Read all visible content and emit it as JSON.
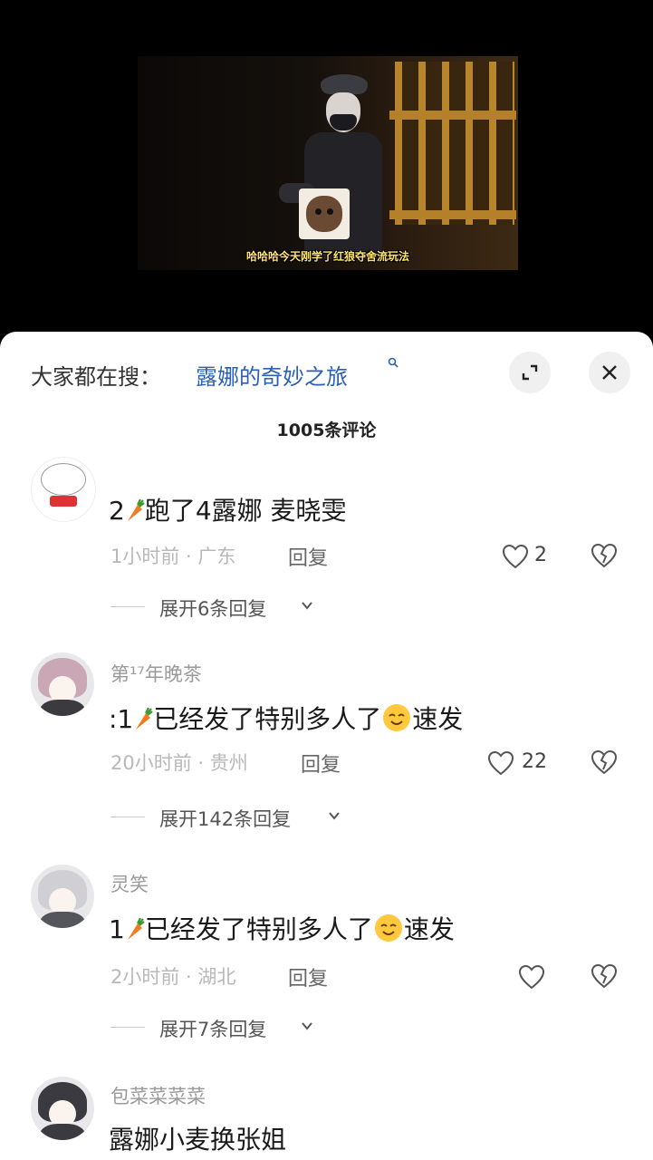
{
  "video": {
    "subtitle": "哈哈哈今天刚学了红狼夺舍流玩法"
  },
  "search": {
    "prefix": "大家都在搜：",
    "term": "露娜的奇妙之旅"
  },
  "comments_header": {
    "count_title": "1005条评论"
  },
  "comments": [
    {
      "username": "",
      "text_before": "2",
      "text_after": "跑了4露娜 麦晓雯",
      "time": "1小时前",
      "location": "广东",
      "reply_label": "回复",
      "likes": "2",
      "expand_label": "展开6条回复"
    },
    {
      "username": "第¹⁷年晚茶",
      "text_before": ":1",
      "text_mid": "已经发了特别多人了",
      "text_after": "速发",
      "time": "20小时前",
      "location": "贵州",
      "reply_label": "回复",
      "likes": "22",
      "expand_label": "展开142条回复"
    },
    {
      "username": "灵笑",
      "text_before": "1",
      "text_mid": "已经发了特别多人了",
      "text_after": "速发",
      "time": "2小时前",
      "location": "湖北",
      "reply_label": "回复",
      "likes": "",
      "expand_label": "展开7条回复"
    },
    {
      "username": "包菜菜菜菜",
      "text": "露娜小麦换张姐"
    }
  ],
  "icons": {
    "search": "search-icon",
    "expand": "expand-icon",
    "close": "close-icon",
    "like": "heart-icon",
    "dislike": "broken-heart-icon",
    "chevron": "chevron-down-icon",
    "carrot": "carrot-emoji",
    "emoji": "smiling-face-emoji"
  },
  "colors": {
    "search_term": "#2a5fb8",
    "subtitle": "#ffe36b"
  }
}
